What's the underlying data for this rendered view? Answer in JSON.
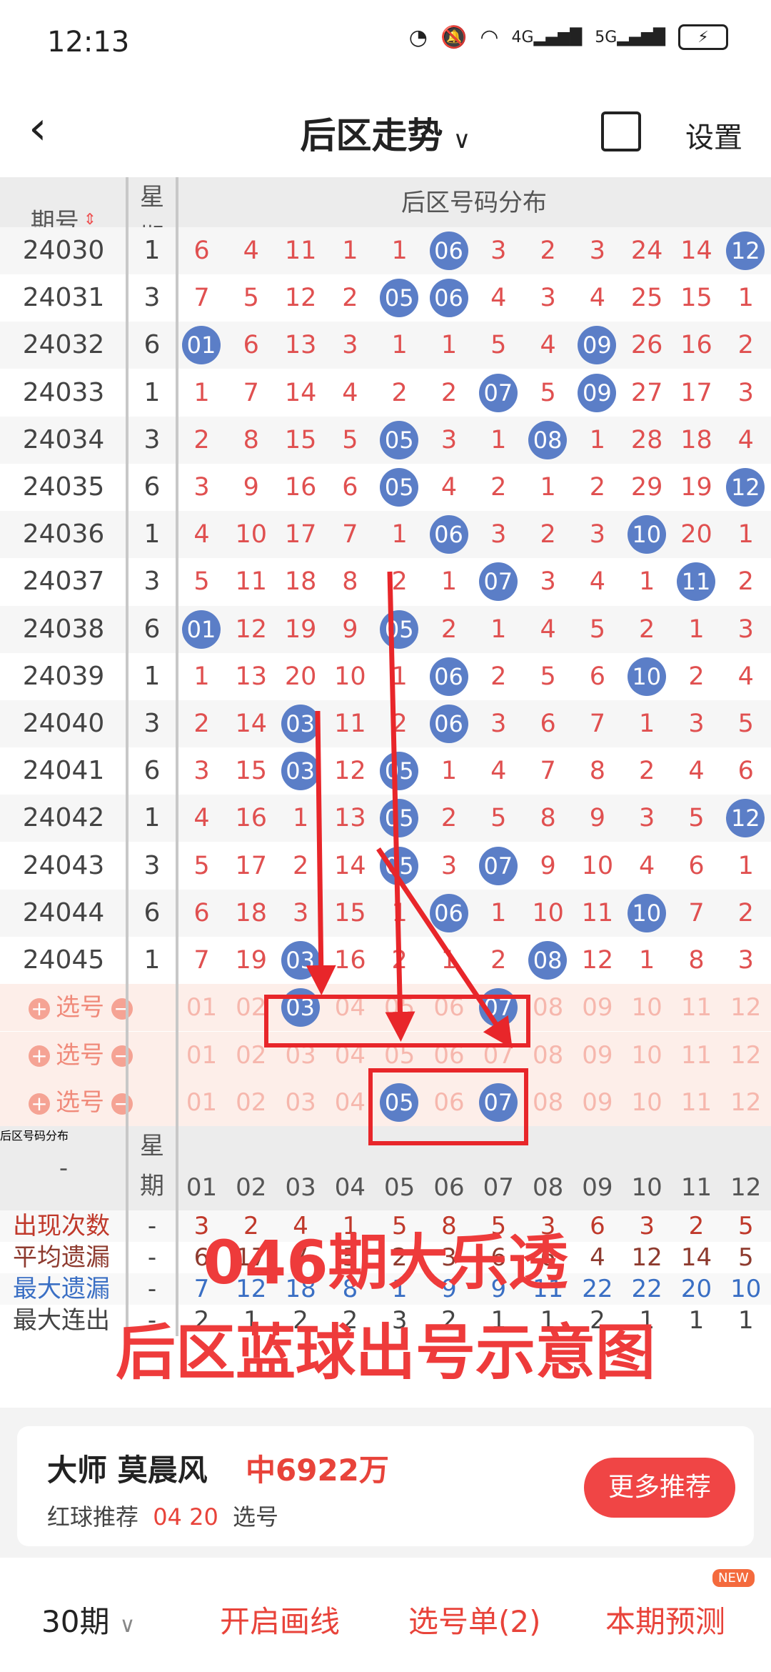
{
  "status_bar": {
    "time": "12:13",
    "net1": "4G",
    "net2": "5G"
  },
  "header": {
    "title": "后区走势",
    "settings": "设置"
  },
  "table_header": {
    "issue": "期号",
    "week_top": "星",
    "week_bottom": "期",
    "caption": "后区号码分布",
    "columns": [
      "01",
      "02",
      "03",
      "04",
      "05",
      "06",
      "07",
      "08",
      "09",
      "10",
      "11",
      "12"
    ]
  },
  "rows": [
    {
      "issue": "24030",
      "week": "1",
      "vals": [
        "6",
        "4",
        "11",
        "1",
        "1",
        "06",
        "3",
        "2",
        "3",
        "24",
        "14",
        "12"
      ],
      "balls": [
        5,
        11
      ]
    },
    {
      "issue": "24031",
      "week": "3",
      "vals": [
        "7",
        "5",
        "12",
        "2",
        "05",
        "06",
        "4",
        "3",
        "4",
        "25",
        "15",
        "1"
      ],
      "balls": [
        4,
        5
      ]
    },
    {
      "issue": "24032",
      "week": "6",
      "vals": [
        "01",
        "6",
        "13",
        "3",
        "1",
        "1",
        "5",
        "4",
        "09",
        "26",
        "16",
        "2"
      ],
      "balls": [
        0,
        8
      ]
    },
    {
      "issue": "24033",
      "week": "1",
      "vals": [
        "1",
        "7",
        "14",
        "4",
        "2",
        "2",
        "07",
        "5",
        "09",
        "27",
        "17",
        "3"
      ],
      "balls": [
        6,
        8
      ]
    },
    {
      "issue": "24034",
      "week": "3",
      "vals": [
        "2",
        "8",
        "15",
        "5",
        "05",
        "3",
        "1",
        "08",
        "1",
        "28",
        "18",
        "4"
      ],
      "balls": [
        4,
        7
      ]
    },
    {
      "issue": "24035",
      "week": "6",
      "vals": [
        "3",
        "9",
        "16",
        "6",
        "05",
        "4",
        "2",
        "1",
        "2",
        "29",
        "19",
        "12"
      ],
      "balls": [
        4,
        11
      ]
    },
    {
      "issue": "24036",
      "week": "1",
      "vals": [
        "4",
        "10",
        "17",
        "7",
        "1",
        "06",
        "3",
        "2",
        "3",
        "10",
        "20",
        "1"
      ],
      "balls": [
        5,
        9
      ]
    },
    {
      "issue": "24037",
      "week": "3",
      "vals": [
        "5",
        "11",
        "18",
        "8",
        "2",
        "1",
        "07",
        "3",
        "4",
        "1",
        "11",
        "2"
      ],
      "balls": [
        6,
        10
      ]
    },
    {
      "issue": "24038",
      "week": "6",
      "vals": [
        "01",
        "12",
        "19",
        "9",
        "05",
        "2",
        "1",
        "4",
        "5",
        "2",
        "1",
        "3"
      ],
      "balls": [
        0,
        4
      ]
    },
    {
      "issue": "24039",
      "week": "1",
      "vals": [
        "1",
        "13",
        "20",
        "10",
        "1",
        "06",
        "2",
        "5",
        "6",
        "10",
        "2",
        "4"
      ],
      "balls": [
        5,
        9
      ]
    },
    {
      "issue": "24040",
      "week": "3",
      "vals": [
        "2",
        "14",
        "03",
        "11",
        "2",
        "06",
        "3",
        "6",
        "7",
        "1",
        "3",
        "5"
      ],
      "balls": [
        2,
        5
      ]
    },
    {
      "issue": "24041",
      "week": "6",
      "vals": [
        "3",
        "15",
        "03",
        "12",
        "05",
        "1",
        "4",
        "7",
        "8",
        "2",
        "4",
        "6"
      ],
      "balls": [
        2,
        4
      ]
    },
    {
      "issue": "24042",
      "week": "1",
      "vals": [
        "4",
        "16",
        "1",
        "13",
        "05",
        "2",
        "5",
        "8",
        "9",
        "3",
        "5",
        "12"
      ],
      "balls": [
        4,
        11
      ]
    },
    {
      "issue": "24043",
      "week": "3",
      "vals": [
        "5",
        "17",
        "2",
        "14",
        "05",
        "3",
        "07",
        "9",
        "10",
        "4",
        "6",
        "1"
      ],
      "balls": [
        4,
        6
      ]
    },
    {
      "issue": "24044",
      "week": "6",
      "vals": [
        "6",
        "18",
        "3",
        "15",
        "1",
        "06",
        "1",
        "10",
        "11",
        "10",
        "7",
        "2"
      ],
      "balls": [
        5,
        9
      ]
    },
    {
      "issue": "24045",
      "week": "1",
      "vals": [
        "7",
        "19",
        "03",
        "16",
        "2",
        "1",
        "2",
        "08",
        "12",
        "1",
        "8",
        "3"
      ],
      "balls": [
        2,
        7
      ]
    }
  ],
  "select_rows": [
    {
      "label": "选号",
      "vals": [
        "01",
        "02",
        "03",
        "04",
        "05",
        "06",
        "07",
        "08",
        "09",
        "10",
        "11",
        "12"
      ],
      "balls": [
        2,
        6
      ]
    },
    {
      "label": "选号",
      "vals": [
        "01",
        "02",
        "03",
        "04",
        "05",
        "06",
        "07",
        "08",
        "09",
        "10",
        "11",
        "12"
      ],
      "balls": []
    },
    {
      "label": "选号",
      "vals": [
        "01",
        "02",
        "03",
        "04",
        "05",
        "06",
        "07",
        "08",
        "09",
        "10",
        "11",
        "12"
      ],
      "balls": [
        4,
        6
      ]
    }
  ],
  "stats_header": {
    "dash": "-",
    "week_top": "星",
    "week_bottom": "期",
    "caption": "后区号码分布"
  },
  "stats": [
    {
      "name": "出现次数",
      "color": "#c0392b",
      "dash": "-",
      "vals": [
        "3",
        "2",
        "4",
        "1",
        "5",
        "8",
        "5",
        "3",
        "6",
        "3",
        "2",
        "5"
      ]
    },
    {
      "name": "平均遗漏",
      "color": "#8e3b2f",
      "dash": "-",
      "vals": [
        "6",
        "17",
        "7",
        "5",
        "2",
        "3",
        "6",
        "6",
        "4",
        "12",
        "14",
        "5"
      ]
    },
    {
      "name": "最大遗漏",
      "color": "#3a6fc4",
      "dash": "-",
      "vals": [
        "7",
        "12",
        "18",
        "8",
        "1",
        "9",
        "9",
        "11",
        "22",
        "22",
        "20",
        "10"
      ]
    },
    {
      "name": "最大连出",
      "color": "#444444",
      "dash": "-",
      "vals": [
        "2",
        "1",
        "2",
        "2",
        "3",
        "2",
        "1",
        "1",
        "2",
        "1",
        "1",
        "1"
      ]
    }
  ],
  "overlay": {
    "line1": "046期大乐透",
    "line2": "后区蓝球出号示意图"
  },
  "card": {
    "title": "大师 莫晨风",
    "prize": "中6922万",
    "rec_label": "红球推荐",
    "rec_nums": "04 20",
    "rec_action": "选号",
    "button": "更多推荐"
  },
  "bottom": {
    "periods": "30期",
    "draw": "开启画线",
    "list": "选号单(2)",
    "predict": "本期预测",
    "badge": "NEW"
  },
  "colors": {
    "ball": "#5b7ec7",
    "value": "#e05050",
    "accent": "#ee3b3b",
    "annotation": "#e8262a"
  }
}
